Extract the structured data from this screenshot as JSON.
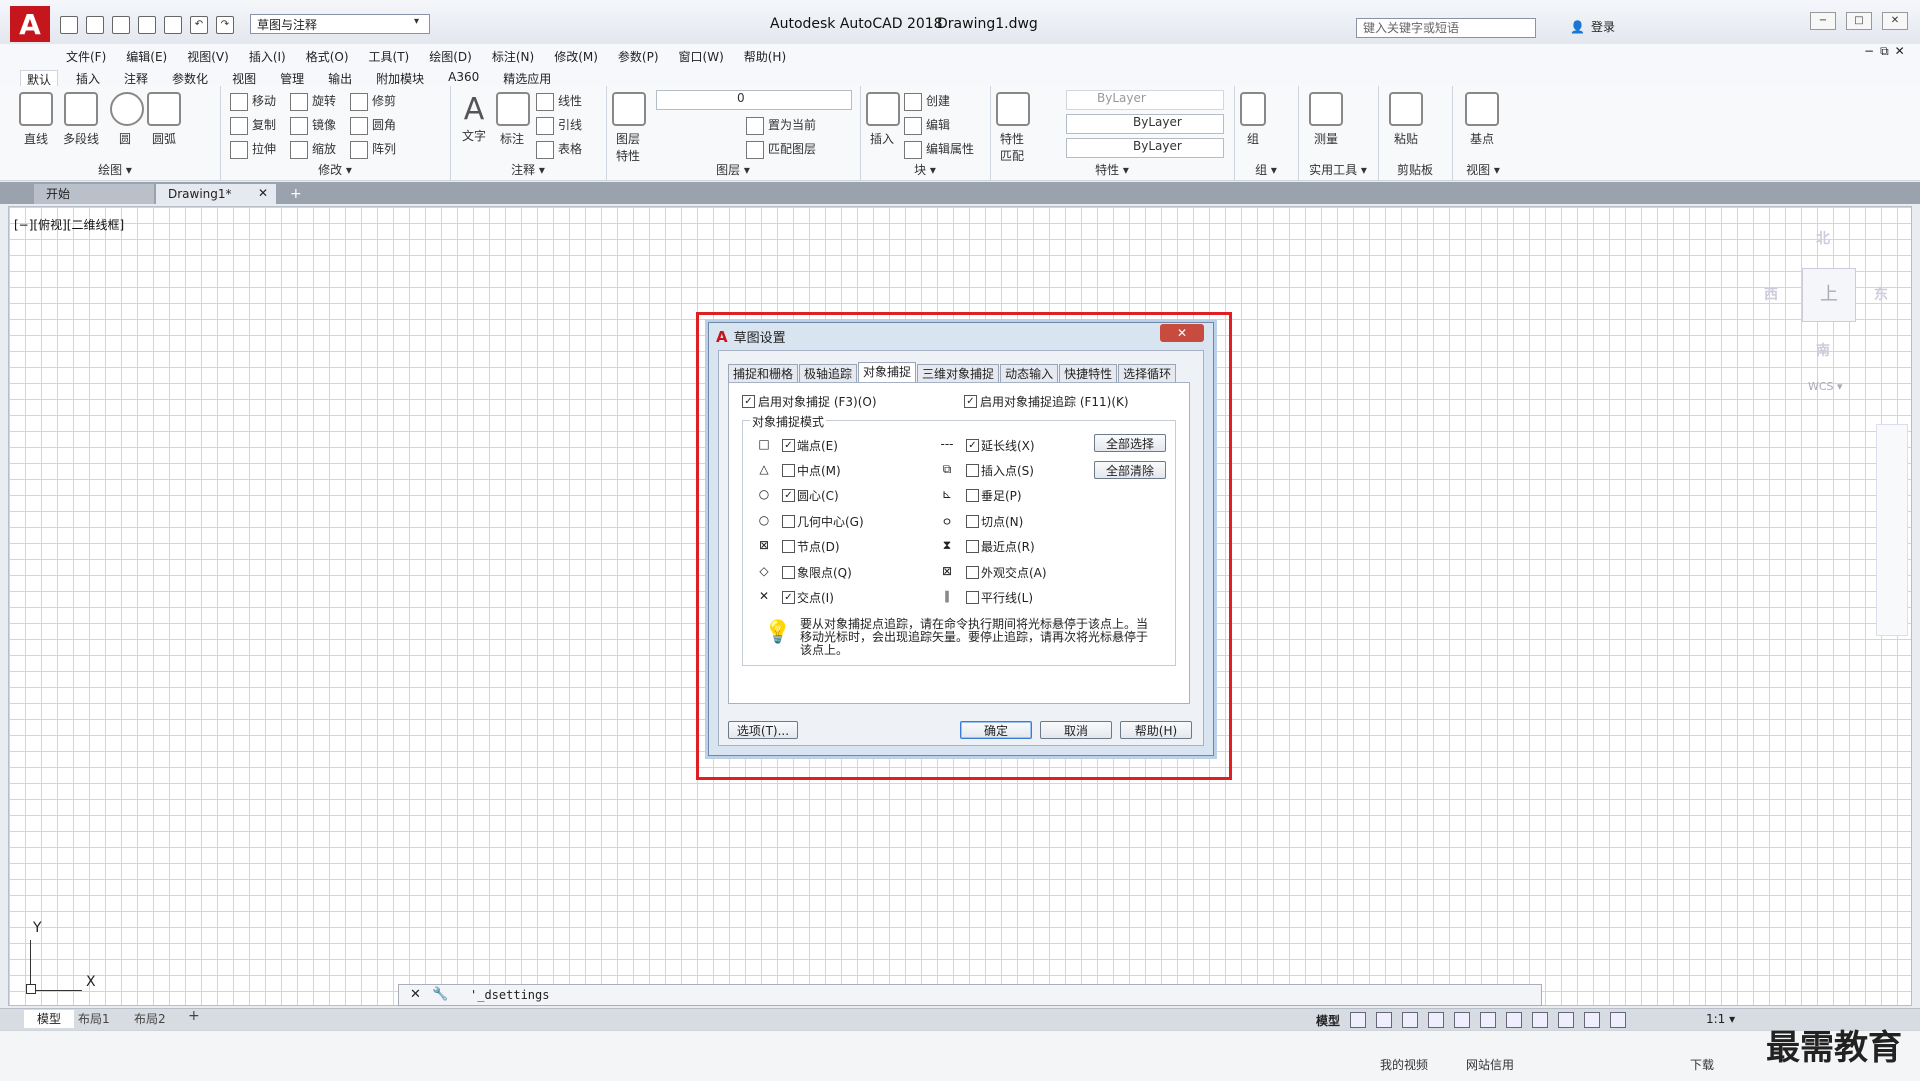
{
  "window": {
    "app_title": "Autodesk AutoCAD 2018",
    "doc_title": "Drawing1.dwg",
    "workspace": "草图与注释",
    "search_placeholder": "键入关键字或短语",
    "login": "登录",
    "logo": "A"
  },
  "menus": [
    "文件(F)",
    "编辑(E)",
    "视图(V)",
    "插入(I)",
    "格式(O)",
    "工具(T)",
    "绘图(D)",
    "标注(N)",
    "修改(M)",
    "参数(P)",
    "窗口(W)",
    "帮助(H)"
  ],
  "ribbon_tabs": [
    "默认",
    "插入",
    "注释",
    "参数化",
    "视图",
    "管理",
    "输出",
    "附加模块",
    "A360",
    "精选应用"
  ],
  "ribbon": {
    "draw": {
      "title": "绘图 ▾",
      "tools": [
        "直线",
        "多段线",
        "圆",
        "圆弧"
      ]
    },
    "modify": {
      "title": "修改 ▾",
      "tools": [
        "移动",
        "旋转",
        "修剪",
        "复制",
        "镜像",
        "圆角",
        "拉伸",
        "缩放",
        "阵列"
      ]
    },
    "annotation": {
      "title": "注释 ▾",
      "tools": [
        "文字",
        "标注",
        "线性",
        "引线",
        "表格"
      ]
    },
    "layer": {
      "title": "图层 ▾",
      "tools": [
        "图层特性",
        "置为当前",
        "匹配图层"
      ],
      "current": "0"
    },
    "block": {
      "title": "块 ▾",
      "tools": [
        "插入",
        "创建",
        "编辑",
        "编辑属性"
      ]
    },
    "properties": {
      "title": "特性 ▾",
      "tools": [
        "特性匹配"
      ],
      "values": [
        "ByLayer",
        "ByLayer",
        "ByLayer"
      ]
    },
    "group": {
      "title": "组 ▾",
      "tools": [
        "组"
      ]
    },
    "utilities": {
      "title": "实用工具 ▾",
      "tools": [
        "测量"
      ]
    },
    "clipboard": {
      "title": "剪贴板",
      "tools": [
        "粘贴"
      ]
    },
    "view": {
      "title": "视图 ▾",
      "tools": [
        "基点"
      ]
    }
  },
  "file_tabs": {
    "start": "开始",
    "drawing": "Drawing1*"
  },
  "viewport_label": "[−][俯视][二维线框]",
  "viewcube": {
    "north": "北",
    "south": "南",
    "east": "东",
    "west": "西",
    "top": "上",
    "wcs": "WCS ▾"
  },
  "ucs": {
    "x": "X",
    "y": "Y"
  },
  "command_line": "'_dsettings",
  "layout_tabs": [
    "模型",
    "布局1",
    "布局2"
  ],
  "status": {
    "model": "模型",
    "scale": "1:1 ▾"
  },
  "taskbar": {
    "video": "我的视频",
    "trust": "网站信用",
    "download": "下载"
  },
  "watermark": "最需教育",
  "dialog": {
    "title": "草图设置",
    "tabs": [
      "捕捉和栅格",
      "极轴追踪",
      "对象捕捉",
      "三维对象捕捉",
      "动态输入",
      "快捷特性",
      "选择循环"
    ],
    "active_tab": "对象捕捉",
    "enable_osnap": "启用对象捕捉 (F3)(O)",
    "enable_tracking": "启用对象捕捉追踪 (F11)(K)",
    "group_title": "对象捕捉模式",
    "modes_left": [
      {
        "label": "端点(E)",
        "checked": true,
        "sym": "□"
      },
      {
        "label": "中点(M)",
        "checked": false,
        "sym": "△"
      },
      {
        "label": "圆心(C)",
        "checked": true,
        "sym": "○"
      },
      {
        "label": "几何中心(G)",
        "checked": false,
        "sym": "○"
      },
      {
        "label": "节点(D)",
        "checked": false,
        "sym": "⊠"
      },
      {
        "label": "象限点(Q)",
        "checked": false,
        "sym": "◇"
      },
      {
        "label": "交点(I)",
        "checked": true,
        "sym": "✕"
      }
    ],
    "modes_right": [
      {
        "label": "延长线(X)",
        "checked": true,
        "sym": "---"
      },
      {
        "label": "插入点(S)",
        "checked": false,
        "sym": "⧉"
      },
      {
        "label": "垂足(P)",
        "checked": false,
        "sym": "⊾"
      },
      {
        "label": "切点(N)",
        "checked": false,
        "sym": "ㅇ"
      },
      {
        "label": "最近点(R)",
        "checked": false,
        "sym": "⧗"
      },
      {
        "label": "外观交点(A)",
        "checked": false,
        "sym": "⊠"
      },
      {
        "label": "平行线(L)",
        "checked": false,
        "sym": "∥"
      }
    ],
    "select_all": "全部选择",
    "clear_all": "全部清除",
    "tip": "要从对象捕捉点追踪，请在命令执行期间将光标悬停于该点上。当移动光标时，会出现追踪矢量。要停止追踪，请再次将光标悬停于该点上。",
    "options_btn": "选项(T)...",
    "ok_btn": "确定",
    "cancel_btn": "取消",
    "help_btn": "帮助(H)",
    "close_btn": "✕"
  }
}
